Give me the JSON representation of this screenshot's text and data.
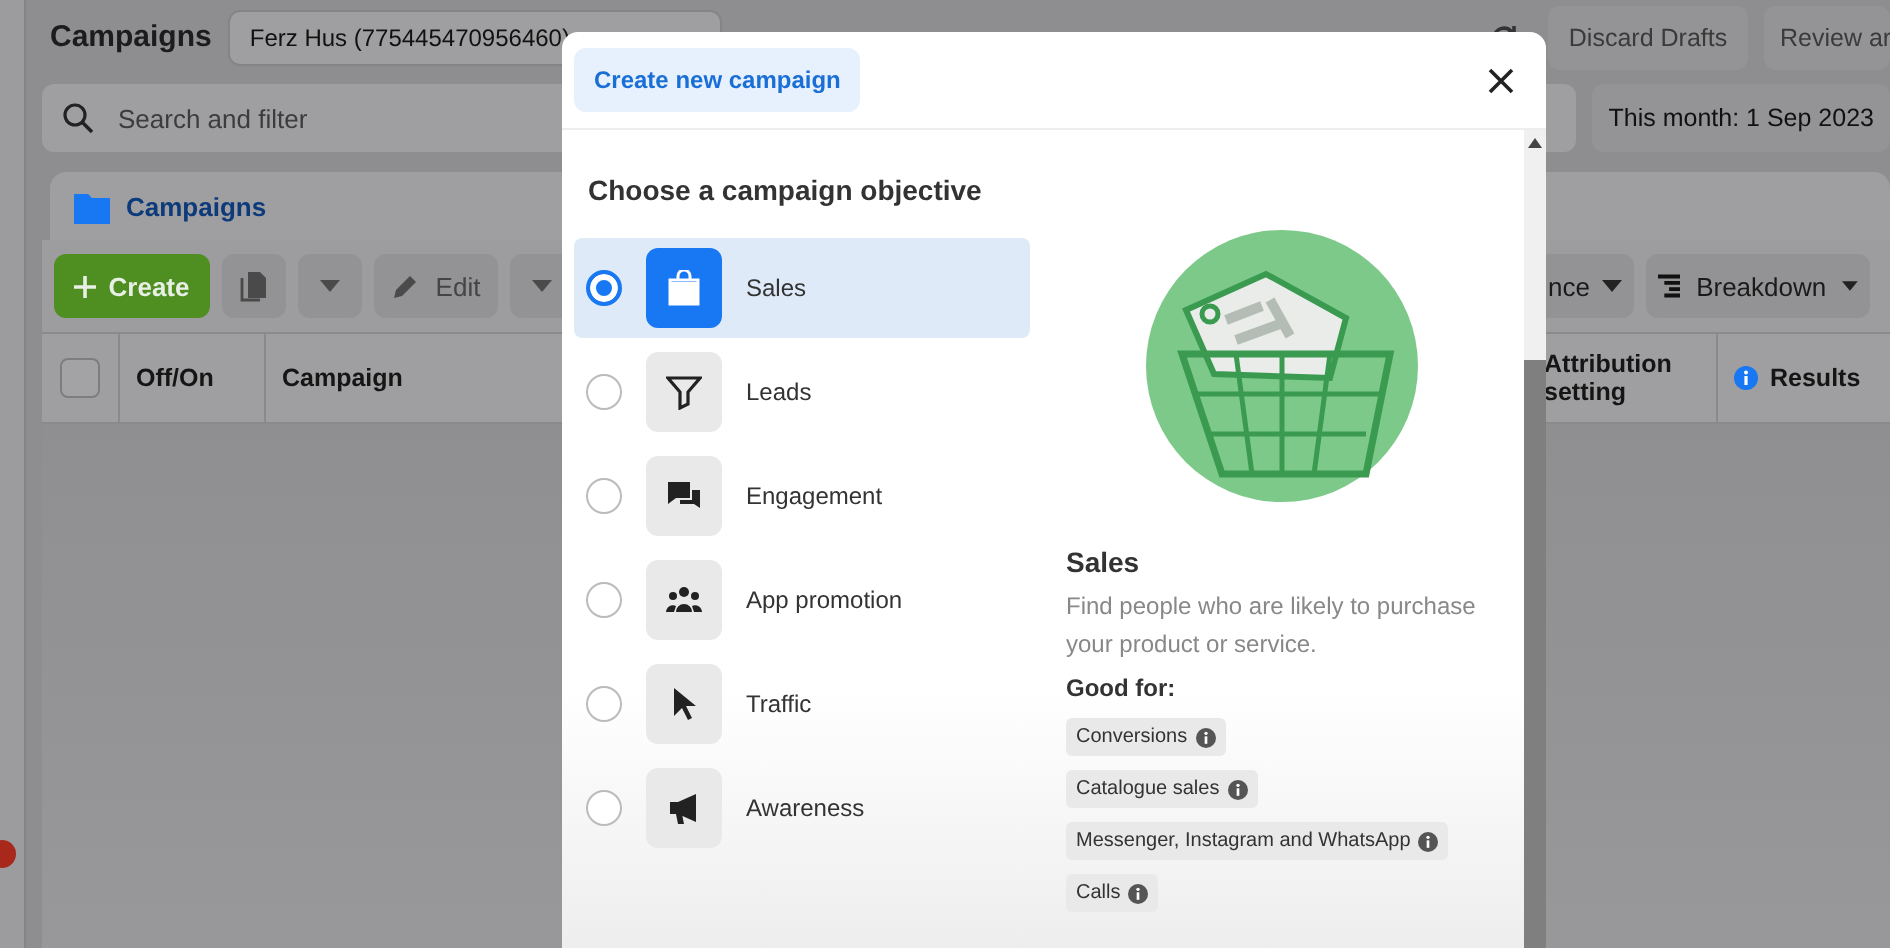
{
  "header": {
    "title": "Campaigns",
    "account": "Ferz Hus (775445470956460)",
    "buttons": [
      "Discard Drafts",
      "Review ar"
    ]
  },
  "search": {
    "placeholder": "Search and filter",
    "date_range": "This month: 1 Sep 2023"
  },
  "tab": {
    "label": "Campaigns"
  },
  "toolbar": {
    "create": "Create",
    "edit": "Edit",
    "columns_partial": "nce",
    "breakdown": "Breakdown"
  },
  "table": {
    "select_all_checked": false,
    "columns": [
      "Off/On",
      "Campaign",
      "Attribution setting",
      "Results"
    ]
  },
  "modal": {
    "tab": {
      "label": "Create new campaign",
      "selected": true
    },
    "heading": "Choose a campaign objective",
    "objectives": [
      {
        "label": "Sales",
        "kind": "bag",
        "selected": true
      },
      {
        "label": "Leads",
        "kind": "funnel",
        "selected": false
      },
      {
        "label": "Engagement",
        "kind": "chat",
        "selected": false
      },
      {
        "label": "App promotion",
        "kind": "people",
        "selected": false
      },
      {
        "label": "Traffic",
        "kind": "cursor",
        "selected": false
      },
      {
        "label": "Awareness",
        "kind": "megaphone",
        "selected": false
      }
    ],
    "detail": {
      "title": "Sales",
      "description": "Find people who are likely to purchase your product or service.",
      "good_for_label": "Good for:",
      "tags": [
        "Conversions",
        "Catalogue sales",
        "Messenger, Instagram and WhatsApp",
        "Calls"
      ]
    }
  }
}
